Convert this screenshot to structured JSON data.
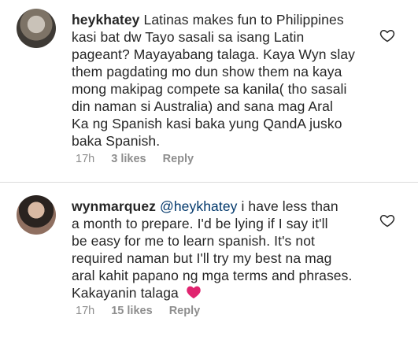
{
  "comments": [
    {
      "username": "heykhatey",
      "lines": [
        "Latinas makes fun to Philippines",
        "kasi bat dw Tayo sasali sa isang Latin",
        "pageant? Mayayabang talaga. Kaya Wyn slay",
        "them pagdating mo dun show them na kaya",
        "mong makipag compete sa kanila( tho sasali",
        "din naman si Australia) and sana mag Aral",
        "Ka ng Spanish kasi baka yung QandA jusko",
        "baka Spanish."
      ],
      "time": "17h",
      "likes": "3 likes",
      "reply": "Reply"
    },
    {
      "username": "wynmarquez",
      "mention": "@heykhatey",
      "first_line_rest": "i have less than",
      "lines": [
        "a month to prepare. I'd be lying if I say it'll",
        "be easy for me to learn spanish. It's not",
        "required naman but I'll try my best na mag",
        "aral kahit papano ng mga terms and phrases."
      ],
      "last_line": "Kakayanin talaga",
      "time": "17h",
      "likes": "15 likes",
      "reply": "Reply"
    }
  ],
  "colors": {
    "text": "#262626",
    "meta": "#8e8e8e",
    "mention": "#00376b",
    "emoji_heart": "#e0246f"
  },
  "icons": [
    "heart-outline-icon",
    "pink-heart-emoji-icon"
  ]
}
